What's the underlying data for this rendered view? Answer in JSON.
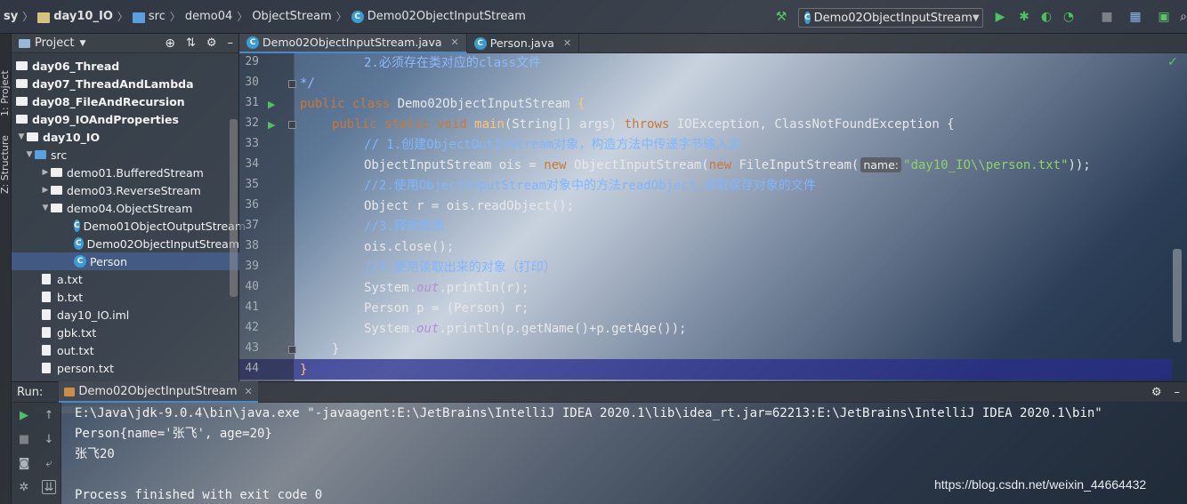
{
  "breadcrumb": {
    "items": [
      "sy",
      "day10_IO",
      "src",
      "demo04",
      "ObjectStream",
      "Demo02ObjectInputStream"
    ]
  },
  "toolbar": {
    "run_config": "Demo02ObjectInputStream",
    "icons": [
      "hammer-icon",
      "run-icon",
      "debug-icon",
      "coverage-icon",
      "profile-icon",
      "stop-icon",
      "project-structure-icon",
      "terminal-icon",
      "search-icon"
    ]
  },
  "side_tabs": {
    "project": "1: Project",
    "structure": "Z: Structure"
  },
  "project_panel": {
    "title": "Project",
    "tree": [
      {
        "label": "day06_Thread",
        "kind": "module"
      },
      {
        "label": "day07_ThreadAndLambda",
        "kind": "module"
      },
      {
        "label": "day08_FileAndRecursion",
        "kind": "module"
      },
      {
        "label": "day09_IOAndProperties",
        "kind": "module"
      },
      {
        "label": "day10_IO",
        "kind": "module"
      },
      {
        "label": "src",
        "kind": "src"
      },
      {
        "label": "demo01.BufferedStream",
        "kind": "package"
      },
      {
        "label": "demo03.ReverseStream",
        "kind": "package"
      },
      {
        "label": "demo04.ObjectStream",
        "kind": "package"
      },
      {
        "label": "Demo01ObjectOutputStream",
        "kind": "class"
      },
      {
        "label": "Demo02ObjectInputStream",
        "kind": "class"
      },
      {
        "label": "Person",
        "kind": "class"
      },
      {
        "label": "a.txt",
        "kind": "file"
      },
      {
        "label": "b.txt",
        "kind": "file"
      },
      {
        "label": "day10_IO.iml",
        "kind": "file"
      },
      {
        "label": "gbk.txt",
        "kind": "file"
      },
      {
        "label": "out.txt",
        "kind": "file"
      },
      {
        "label": "person.txt",
        "kind": "file"
      }
    ]
  },
  "editor": {
    "tabs": [
      "Demo02ObjectInputStream.java",
      "Person.java"
    ],
    "line_numbers": [
      "29",
      "30",
      "31",
      "32",
      "33",
      "34",
      "35",
      "36",
      "37",
      "38",
      "39",
      "40",
      "41",
      "42",
      "43",
      "44"
    ],
    "param_hint": "name:",
    "lines": {
      "l29": "2.必须存在类对应的class文件",
      "l30": "*/",
      "l31_kw": "public class ",
      "l31_name": "Demo02ObjectInputStream",
      "l31_brace": " {",
      "l32_kw": "public static void ",
      "l32_fn": "main",
      "l32_args": "(String[] args) ",
      "l32_throws": "throws",
      "l32_rest": " IOException, ClassNotFoundException {",
      "l33": "// 1.创建ObjectOutInStream对象，构造方法中传递字节输入流",
      "l34_a": "ObjectInputStream ois = ",
      "l34_new1": "new",
      "l34_b": " ObjectInputStream(",
      "l34_new2": "new",
      "l34_c": " FileInputStream(",
      "l34_str": "\"day10_IO\\\\person.txt\"",
      "l34_end": "));",
      "l35": "//2.使用ObjectInputStream对象中的方法readObject,读取保存对象的文件",
      "l36": "Object r = ois.readObject();",
      "l37": "//3.释放资源",
      "l38": "ois.close();",
      "l39": "//4.使用读取出来的对象（打印）",
      "l40_a": "System.",
      "l40_out": "out",
      "l40_b": ".println(r);",
      "l41": "Person p = (Person) r;",
      "l42_a": "System.",
      "l42_out": "out",
      "l42_b": ".println(p.getName()+p.getAge());",
      "l43": "}",
      "l44": "}"
    }
  },
  "run_panel": {
    "label": "Run:",
    "tab": "Demo02ObjectInputStream",
    "output": [
      "E:\\Java\\jdk-9.0.4\\bin\\java.exe \"-javaagent:E:\\JetBrains\\IntelliJ IDEA 2020.1\\lib\\idea_rt.jar=62213:E:\\JetBrains\\IntelliJ IDEA 2020.1\\bin\"",
      "Person{name='张飞', age=20}",
      "张飞20",
      "",
      "Process finished with exit code 0"
    ]
  },
  "watermark": "https://blog.csdn.net/weixin_44664432",
  "colors": {
    "keyword": "#cc7832",
    "string": "#8bd36a",
    "comment": "#7eb6ff",
    "method": "#ffc66d",
    "run_green": "#4ec260"
  }
}
